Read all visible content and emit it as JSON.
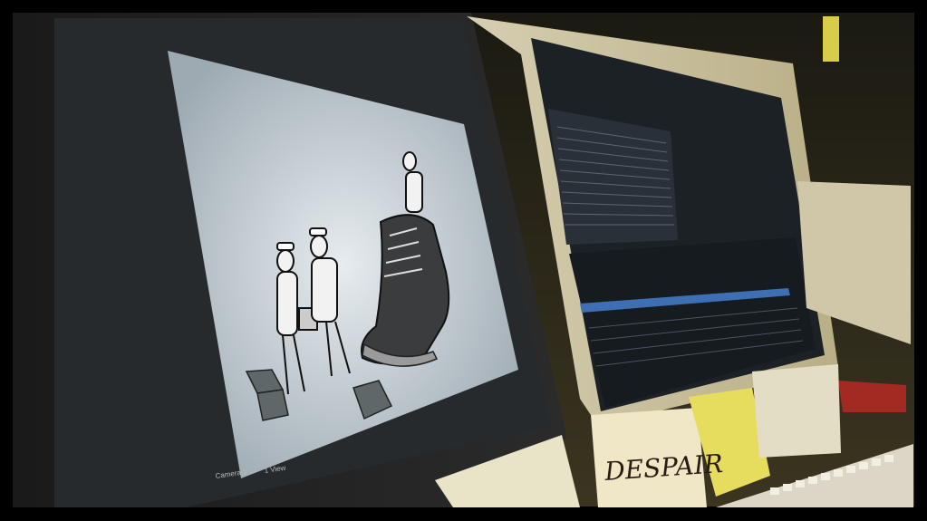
{
  "photo": {
    "left_monitor": {
      "viewport_label": "Camera 2",
      "view_label": "1 View"
    },
    "sticky_note": {
      "text": "DESPAIR"
    }
  }
}
